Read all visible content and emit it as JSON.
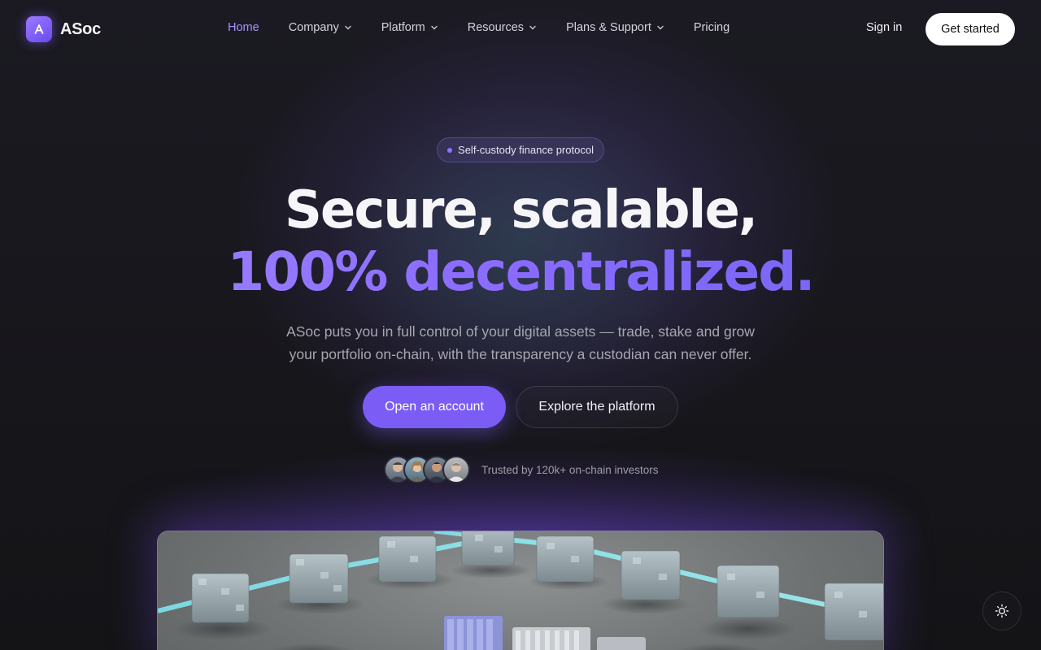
{
  "brand": {
    "name": "ASoc",
    "logo_icon": "a-logo-icon",
    "accent": "#7b5cf5"
  },
  "nav": {
    "items": [
      {
        "label": "Home",
        "has_dropdown": false,
        "active": true
      },
      {
        "label": "Company",
        "has_dropdown": true
      },
      {
        "label": "Platform",
        "has_dropdown": true
      },
      {
        "label": "Resources",
        "has_dropdown": true
      },
      {
        "label": "Plans & Support",
        "has_dropdown": true
      },
      {
        "label": "Pricing",
        "has_dropdown": false
      }
    ],
    "sign_in": "Sign in",
    "get_started": "Get started"
  },
  "hero": {
    "badge": "Self-custody finance protocol",
    "title_line1": "Secure, scalable,",
    "title_line2": "100% decentralized.",
    "subtitle": "ASoc puts you in full control of your digital assets — trade, stake and grow your portfolio on-chain, with the transparency a custodian can never offer.",
    "primary_cta": "Open an account",
    "secondary_cta": "Explore the platform",
    "trust_text": "Trusted by 120k+ on-chain investors",
    "avatar_count": 4
  },
  "preview": {
    "alt_icon": "blockchain-cubes-illustration"
  },
  "theme_toggle": {
    "icon": "sun-icon"
  }
}
